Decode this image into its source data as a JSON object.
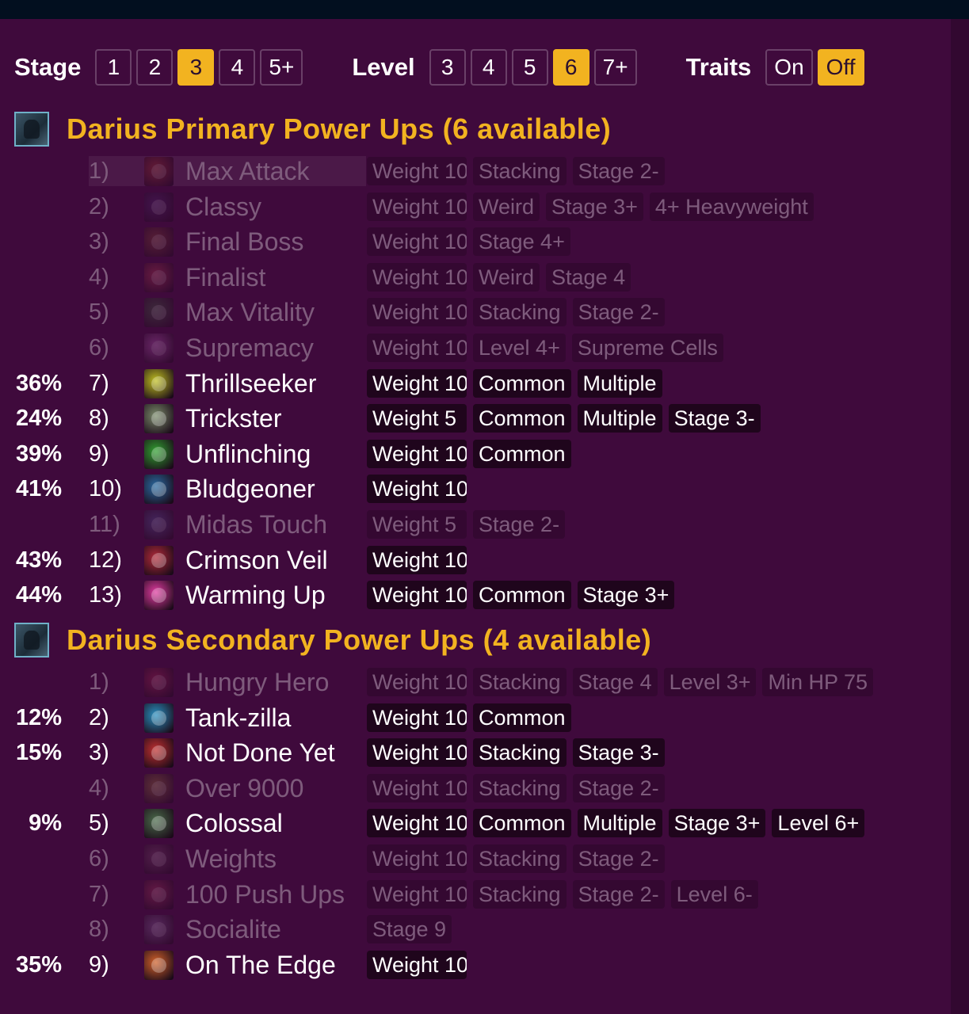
{
  "filters": {
    "stage": {
      "label": "Stage",
      "options": [
        "1",
        "2",
        "3",
        "4",
        "5+"
      ],
      "selected": "3"
    },
    "level": {
      "label": "Level",
      "options": [
        "3",
        "4",
        "5",
        "6",
        "7+"
      ],
      "selected": "6"
    },
    "traits": {
      "label": "Traits",
      "options": [
        "On",
        "Off"
      ],
      "selected": "Off"
    }
  },
  "sections": [
    {
      "title": "Darius Primary Power Ups (6 available)",
      "rows": [
        {
          "pct": "",
          "num": "1)",
          "name": "Max Attack",
          "tags": [
            "Weight 10",
            "Stacking",
            "Stage 2-"
          ],
          "active": false,
          "highlight": true,
          "icon": "max-attack-icon",
          "color": "#b0402a"
        },
        {
          "pct": "",
          "num": "2)",
          "name": "Classy",
          "tags": [
            "Weight 10",
            "Weird",
            "Stage 3+",
            "4+ Heavyweight"
          ],
          "active": false,
          "icon": "classy-icon",
          "color": "#4a2a70"
        },
        {
          "pct": "",
          "num": "3)",
          "name": "Final Boss",
          "tags": [
            "Weight 10",
            "Stage 4+"
          ],
          "active": false,
          "icon": "final-boss-icon",
          "color": "#8a4a2a"
        },
        {
          "pct": "",
          "num": "4)",
          "name": "Finalist",
          "tags": [
            "Weight 10",
            "Weird",
            "Stage 4"
          ],
          "active": false,
          "icon": "finalist-icon",
          "color": "#c04050"
        },
        {
          "pct": "",
          "num": "5)",
          "name": "Max Vitality",
          "tags": [
            "Weight 10",
            "Stacking",
            "Stage 2-"
          ],
          "active": false,
          "icon": "max-vitality-icon",
          "color": "#3a6a3a"
        },
        {
          "pct": "",
          "num": "6)",
          "name": "Supremacy",
          "tags": [
            "Weight 10",
            "Level 4+",
            "Supreme Cells"
          ],
          "active": false,
          "icon": "supremacy-icon",
          "color": "#c060c0"
        },
        {
          "pct": "36%",
          "num": "7)",
          "name": "Thrillseeker",
          "tags": [
            "Weight 10",
            "Common",
            "Multiple"
          ],
          "active": true,
          "icon": "thrillseeker-icon",
          "color": "#c0c020"
        },
        {
          "pct": "24%",
          "num": "8)",
          "name": "Trickster",
          "tags": [
            "Weight 5",
            "Common",
            "Multiple",
            "Stage 3-"
          ],
          "active": true,
          "icon": "trickster-icon",
          "color": "#7a8a6a"
        },
        {
          "pct": "39%",
          "num": "9)",
          "name": "Unflinching",
          "tags": [
            "Weight 10",
            "Common"
          ],
          "active": true,
          "icon": "unflinching-icon",
          "color": "#30a030"
        },
        {
          "pct": "41%",
          "num": "10)",
          "name": "Bludgeoner",
          "tags": [
            "Weight 10"
          ],
          "active": true,
          "icon": "bludgeoner-icon",
          "color": "#2a6aa0"
        },
        {
          "pct": "",
          "num": "11)",
          "name": "Midas Touch",
          "tags": [
            "Weight 5",
            "Stage 2-"
          ],
          "active": false,
          "icon": "midas-touch-icon",
          "color": "#5060a0"
        },
        {
          "pct": "43%",
          "num": "12)",
          "name": "Crimson Veil",
          "tags": [
            "Weight 10"
          ],
          "active": true,
          "icon": "crimson-veil-icon",
          "color": "#b02a3a"
        },
        {
          "pct": "44%",
          "num": "13)",
          "name": "Warming Up",
          "tags": [
            "Weight 10",
            "Common",
            "Stage 3+"
          ],
          "active": true,
          "icon": "warming-up-icon",
          "color": "#e03aa0"
        }
      ]
    },
    {
      "title": "Darius Secondary Power Ups (4 available)",
      "rows": [
        {
          "pct": "",
          "num": "1)",
          "name": "Hungry Hero",
          "tags": [
            "Weight 10",
            "Stacking",
            "Stage 4",
            "Level 3+",
            "Min HP 75"
          ],
          "active": false,
          "icon": "hungry-hero-icon",
          "color": "#b02a50"
        },
        {
          "pct": "12%",
          "num": "2)",
          "name": "Tank-zilla",
          "tags": [
            "Weight 10",
            "Common"
          ],
          "active": true,
          "icon": "tank-zilla-icon",
          "color": "#2a90c0"
        },
        {
          "pct": "15%",
          "num": "3)",
          "name": "Not Done Yet",
          "tags": [
            "Weight 10",
            "Stacking",
            "Stage 3-"
          ],
          "active": true,
          "icon": "not-done-yet-icon",
          "color": "#c03030"
        },
        {
          "pct": "",
          "num": "4)",
          "name": "Over 9000",
          "tags": [
            "Weight 10",
            "Stacking",
            "Stage 2-"
          ],
          "active": false,
          "icon": "over-9000-icon",
          "color": "#a08030"
        },
        {
          "pct": "9%",
          "num": "5)",
          "name": "Colossal",
          "tags": [
            "Weight 10",
            "Common",
            "Multiple",
            "Stage 3+",
            "Level 6+"
          ],
          "active": true,
          "icon": "colossal-icon",
          "color": "#4a6a4a"
        },
        {
          "pct": "",
          "num": "6)",
          "name": "Weights",
          "tags": [
            "Weight 10",
            "Stacking",
            "Stage 2-"
          ],
          "active": false,
          "icon": "weights-icon",
          "color": "#7a4a6a"
        },
        {
          "pct": "",
          "num": "7)",
          "name": "100 Push Ups",
          "tags": [
            "Weight 10",
            "Stacking",
            "Stage 2-",
            "Level 6-"
          ],
          "active": false,
          "icon": "push-ups-icon",
          "color": "#b03a5a"
        },
        {
          "pct": "",
          "num": "8)",
          "name": "Socialite",
          "tags": [
            "Stage 9"
          ],
          "active": false,
          "icon": "socialite-icon",
          "color": "#8a6aa0"
        },
        {
          "pct": "35%",
          "num": "9)",
          "name": "On The Edge",
          "tags": [
            "Weight 10"
          ],
          "active": true,
          "icon": "on-the-edge-icon",
          "color": "#d0602a"
        }
      ]
    }
  ]
}
